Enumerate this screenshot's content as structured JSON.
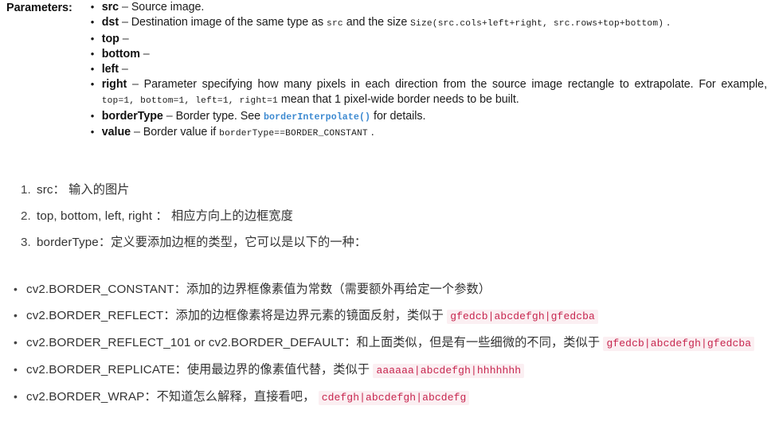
{
  "colors": {
    "page_background": "#ffffff",
    "body_text": "#333333",
    "param_text": "#1b1b1b",
    "inline_code_text": "#c7254e",
    "inline_code_background": "#fbeff2",
    "api_link": "#3d8ad1"
  },
  "parameters_section": {
    "label": "Parameters:",
    "items": [
      {
        "name": "src",
        "dash": " – ",
        "desc_before": "Source image.",
        "code": "",
        "desc_after": ""
      },
      {
        "name": "dst",
        "dash": " – ",
        "desc_before": "Destination image of the same type as ",
        "code_inline_1": "src",
        "desc_mid": " and the size ",
        "code_inline_2": "Size(src.cols+left+right, src.rows+top+bottom)",
        "desc_after": " ."
      },
      {
        "name": "top",
        "dash": " –",
        "desc_before": "",
        "code": "",
        "desc_after": ""
      },
      {
        "name": "bottom",
        "dash": " –",
        "desc_before": "",
        "code": "",
        "desc_after": ""
      },
      {
        "name": "left",
        "dash": " –",
        "desc_before": "",
        "code": "",
        "desc_after": ""
      },
      {
        "name": "right",
        "dash": " – ",
        "desc_before": "Parameter specifying how many pixels in each direction from the source image rectangle to extrapolate. For example,",
        "code_inline_1": "top=1, bottom=1, left=1, right=1",
        "desc_after": "mean that 1 pixel-wide border needs to be built."
      },
      {
        "name": "borderType",
        "dash": " – ",
        "desc_before": "Border type. See ",
        "link_text": "borderInterpolate()",
        "desc_after": " for details."
      },
      {
        "name": "value",
        "dash": " – ",
        "desc_before": "Border value if ",
        "code_inline_1": "borderType==BORDER_CONSTANT",
        "desc_after": " ."
      }
    ]
  },
  "numbered_notes": [
    {
      "text": "src： 输入的图片"
    },
    {
      "text": "top, bottom, left, right ： 相应方向上的边框宽度"
    },
    {
      "text": "borderType：定义要添加边框的类型，它可以是以下的一种："
    }
  ],
  "border_type_bullets": [
    {
      "text": "cv2.BORDER_CONSTANT：添加的边界框像素值为常数（需要额外再给定一个参数）",
      "code": ""
    },
    {
      "text": "cv2.BORDER_REFLECT：添加的边框像素将是边界元素的镜面反射，类似于 ",
      "code": "gfedcb|abcdefgh|gfedcba"
    },
    {
      "text": "cv2.BORDER_REFLECT_101 or cv2.BORDER_DEFAULT：和上面类似，但是有一些细微的不同，类似于 ",
      "code": "gfedcb|abcdefgh|gfedcba"
    },
    {
      "text": "cv2.BORDER_REPLICATE：使用最边界的像素值代替，类似于 ",
      "code": "aaaaaa|abcdefgh|hhhhhhh"
    },
    {
      "text": "cv2.BORDER_WRAP：不知道怎么解释，直接看吧， ",
      "code": "cdefgh|abcdefgh|abcdefg"
    }
  ]
}
